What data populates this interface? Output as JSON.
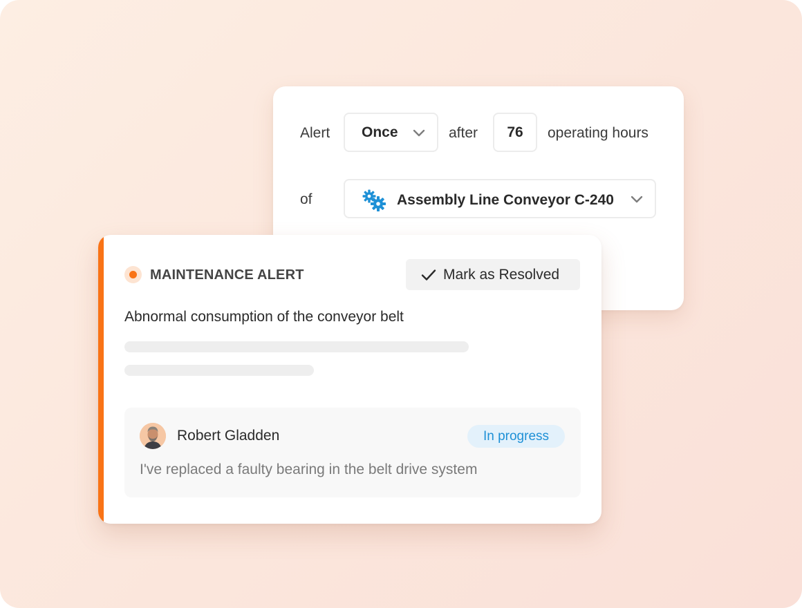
{
  "rule": {
    "alert_label": "Alert",
    "frequency": "Once",
    "after_label": "after",
    "hours_value": "76",
    "hours_label": "operating hours",
    "of_label": "of",
    "equipment": "Assembly Line Conveyor C-240",
    "equipment_icon": "gears-icon"
  },
  "alert": {
    "type_label": "MAINTENANCE ALERT",
    "resolve_label": "Mark as Resolved",
    "title": "Abnormal consumption of the conveyor belt",
    "accent_color": "#f97316",
    "comment": {
      "author": "Robert Gladden",
      "status": "In progress",
      "text": "I've replaced a faulty bearing in the belt drive system"
    }
  }
}
